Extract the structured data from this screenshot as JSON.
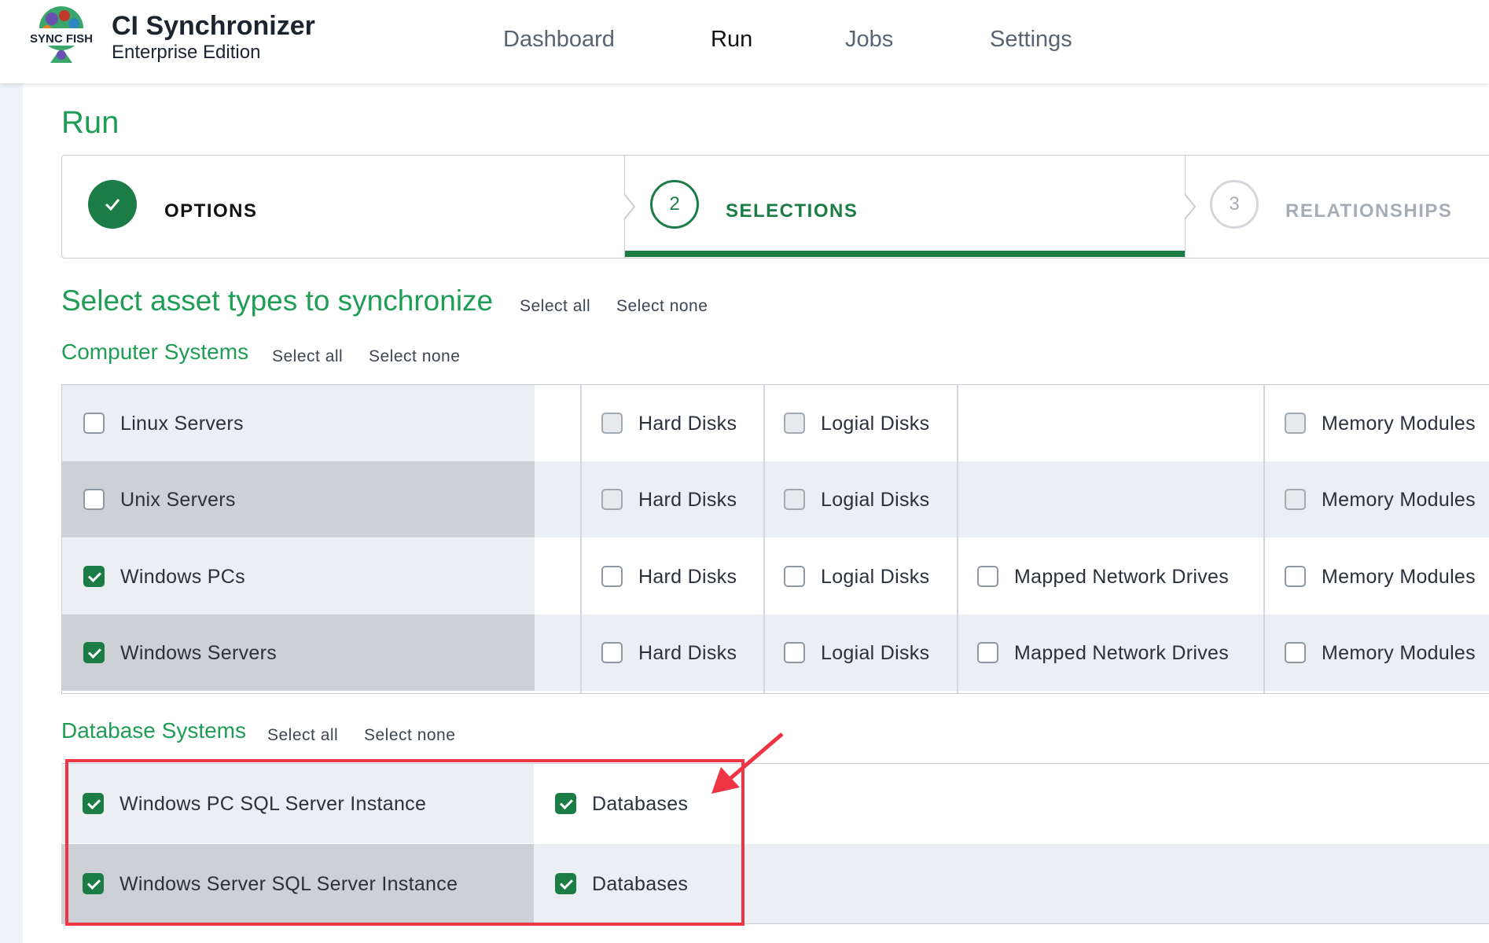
{
  "header": {
    "logo_text": "SYNC FISH",
    "title": "CI Synchronizer",
    "subtitle": "Enterprise Edition",
    "nav": [
      {
        "label": "Dashboard",
        "active": false
      },
      {
        "label": "Run",
        "active": true
      },
      {
        "label": "Jobs",
        "active": false
      },
      {
        "label": "Settings",
        "active": false
      }
    ]
  },
  "page": {
    "title": "Run"
  },
  "stepper": {
    "steps": [
      {
        "number": "1",
        "label": "OPTIONS",
        "state": "complete"
      },
      {
        "number": "2",
        "label": "SELECTIONS",
        "state": "active"
      },
      {
        "number": "3",
        "label": "RELATIONSHIPS",
        "state": "upcoming"
      }
    ]
  },
  "selection": {
    "heading": "Select asset types to synchronize",
    "select_all": "Select all",
    "select_none": "Select none"
  },
  "computer_systems": {
    "heading": "Computer Systems",
    "select_all": "Select all",
    "select_none": "Select none",
    "rows": [
      {
        "name": "Linux Servers",
        "checked": false,
        "cols": [
          {
            "label": "Hard Disks",
            "checked": false,
            "disabled": true
          },
          {
            "label": "Logial Disks",
            "checked": false,
            "disabled": true
          },
          null,
          {
            "label": "Memory Modules",
            "checked": false,
            "disabled": true
          }
        ]
      },
      {
        "name": "Unix Servers",
        "checked": false,
        "cols": [
          {
            "label": "Hard Disks",
            "checked": false,
            "disabled": true
          },
          {
            "label": "Logial Disks",
            "checked": false,
            "disabled": true
          },
          null,
          {
            "label": "Memory Modules",
            "checked": false,
            "disabled": true
          }
        ]
      },
      {
        "name": "Windows PCs",
        "checked": true,
        "cols": [
          {
            "label": "Hard Disks",
            "checked": false,
            "disabled": false
          },
          {
            "label": "Logial Disks",
            "checked": false,
            "disabled": false
          },
          {
            "label": "Mapped Network Drives",
            "checked": false,
            "disabled": false
          },
          {
            "label": "Memory Modules",
            "checked": false,
            "disabled": false
          }
        ]
      },
      {
        "name": "Windows Servers",
        "checked": true,
        "cols": [
          {
            "label": "Hard Disks",
            "checked": false,
            "disabled": false
          },
          {
            "label": "Logial Disks",
            "checked": false,
            "disabled": false
          },
          {
            "label": "Mapped Network Drives",
            "checked": false,
            "disabled": false
          },
          {
            "label": "Memory Modules",
            "checked": false,
            "disabled": false
          }
        ]
      }
    ]
  },
  "database_systems": {
    "heading": "Database Systems",
    "select_all": "Select all",
    "select_none": "Select none",
    "rows": [
      {
        "name": "Windows PC SQL Server Instance",
        "checked": true,
        "child": {
          "label": "Databases",
          "checked": true
        }
      },
      {
        "name": "Windows Server SQL Server Instance",
        "checked": true,
        "child": {
          "label": "Databases",
          "checked": true
        }
      }
    ]
  },
  "colors": {
    "accent_green": "#1f9d55",
    "check_green": "#1b7d45",
    "highlight_red": "#ef3543"
  }
}
